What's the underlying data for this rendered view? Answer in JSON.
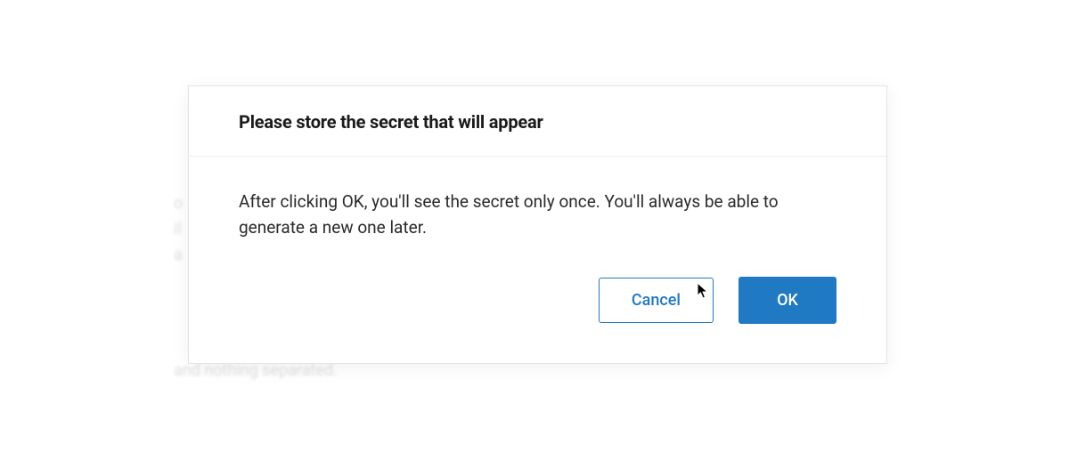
{
  "dialog": {
    "title": "Please store the secret that will appear",
    "message": "After clicking OK, you'll see the secret only once. You'll always be able to generate a new one later.",
    "cancel_label": "Cancel",
    "ok_label": "OK"
  },
  "backdrop": {
    "line1": "o",
    "line2": "il",
    "line3": "a",
    "bottom_line": "and nothing separated."
  },
  "colors": {
    "primary": "#2079c3",
    "border": "#e1e4e8",
    "text": "#1a1a1a"
  }
}
